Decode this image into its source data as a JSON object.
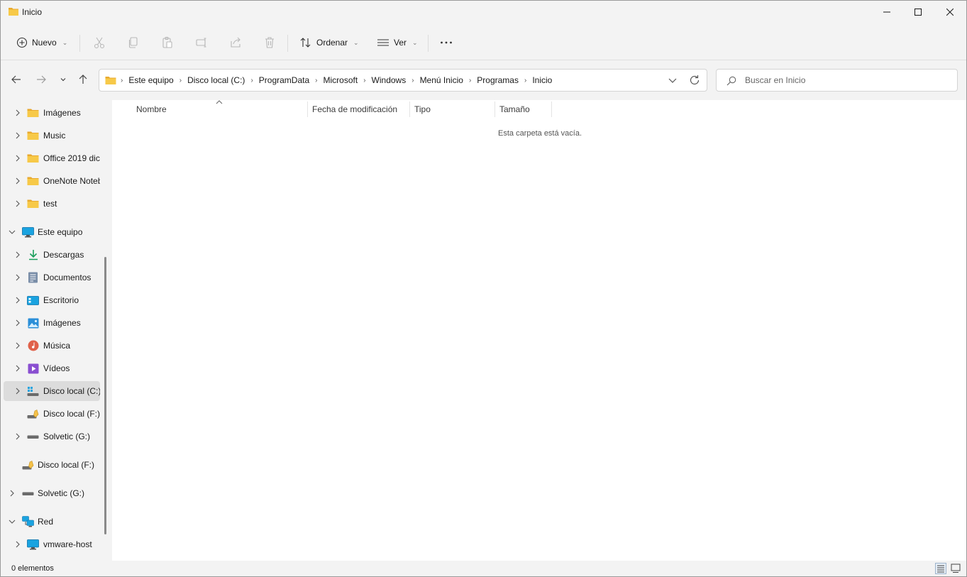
{
  "window": {
    "title": "Inicio",
    "minimize_icon": "minimize-icon",
    "maximize_icon": "maximize-icon",
    "close_icon": "close-icon"
  },
  "commands": {
    "new_label": "Nuevo",
    "sort_label": "Ordenar",
    "view_label": "Ver",
    "icons": [
      "add-icon",
      "cut-icon",
      "copy-icon",
      "paste-icon",
      "rename-icon",
      "share-icon",
      "delete-icon",
      "sort-icon",
      "view-icon",
      "more-icon"
    ]
  },
  "address": {
    "crumbs": [
      "Este equipo",
      "Disco local (C:)",
      "ProgramData",
      "Microsoft",
      "Windows",
      "Menú Inicio",
      "Programas",
      "Inicio"
    ]
  },
  "search": {
    "placeholder": "Buscar en Inicio"
  },
  "sidebar": {
    "items": [
      {
        "label": "Imágenes",
        "icon": "folder-icon"
      },
      {
        "label": "Music",
        "icon": "folder-icon"
      },
      {
        "label": "Office 2019 dic",
        "icon": "folder-icon"
      },
      {
        "label": "OneNote Notebooks",
        "icon": "folder-icon"
      },
      {
        "label": "test",
        "icon": "folder-icon"
      },
      {
        "label": "Este equipo",
        "icon": "computer-icon"
      },
      {
        "label": "Descargas",
        "icon": "download-icon"
      },
      {
        "label": "Documentos",
        "icon": "documents-icon"
      },
      {
        "label": "Escritorio",
        "icon": "desktop-icon"
      },
      {
        "label": "Imágenes",
        "icon": "pictures-icon"
      },
      {
        "label": "Música",
        "icon": "music-icon"
      },
      {
        "label": "Vídeos",
        "icon": "videos-icon"
      },
      {
        "label": "Disco local (C:)",
        "icon": "windows-drive-icon"
      },
      {
        "label": "Disco local (F:)",
        "icon": "shared-drive-icon"
      },
      {
        "label": "Solvetic (G:)",
        "icon": "drive-icon"
      },
      {
        "label": "Disco local (F:)",
        "icon": "shared-drive-icon"
      },
      {
        "label": "Solvetic (G:)",
        "icon": "drive-icon"
      },
      {
        "label": "Red",
        "icon": "network-icon"
      },
      {
        "label": "vmware-host",
        "icon": "computer-icon"
      }
    ]
  },
  "content": {
    "columns": [
      "Nombre",
      "Fecha de modificación",
      "Tipo",
      "Tamaño"
    ],
    "empty_message": "Esta carpeta está vacía."
  },
  "status": {
    "item_count": "0 elementos"
  },
  "colors": {
    "folder_yellow": "#f7c948",
    "accent_blue": "#0a84d8",
    "selected_bg": "#dcdcdc"
  }
}
